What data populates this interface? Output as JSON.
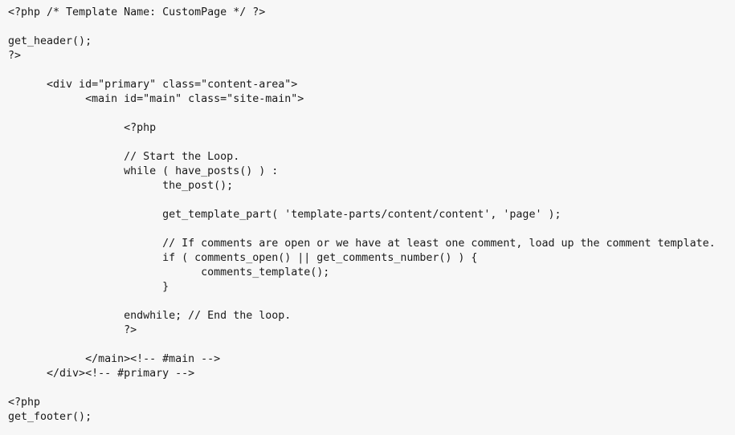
{
  "document": {
    "language": "php",
    "background_color": "#f7f7f7",
    "text_color": "#1a1a1a",
    "lines": [
      "<?php /* Template Name: CustomPage */ ?>",
      "",
      "get_header();",
      "?>",
      "",
      "      <div id=\"primary\" class=\"content-area\">",
      "            <main id=\"main\" class=\"site-main\">",
      "",
      "                  <?php",
      "",
      "                  // Start the Loop.",
      "                  while ( have_posts() ) :",
      "                        the_post();",
      "",
      "                        get_template_part( 'template-parts/content/content', 'page' );",
      "",
      "                        // If comments are open or we have at least one comment, load up the comment template.",
      "                        if ( comments_open() || get_comments_number() ) {",
      "                              comments_template();",
      "                        }",
      "",
      "                  endwhile; // End the loop.",
      "                  ?>",
      "",
      "            </main><!-- #main -->",
      "      </div><!-- #primary -->",
      "",
      "<?php",
      "get_footer();"
    ]
  }
}
